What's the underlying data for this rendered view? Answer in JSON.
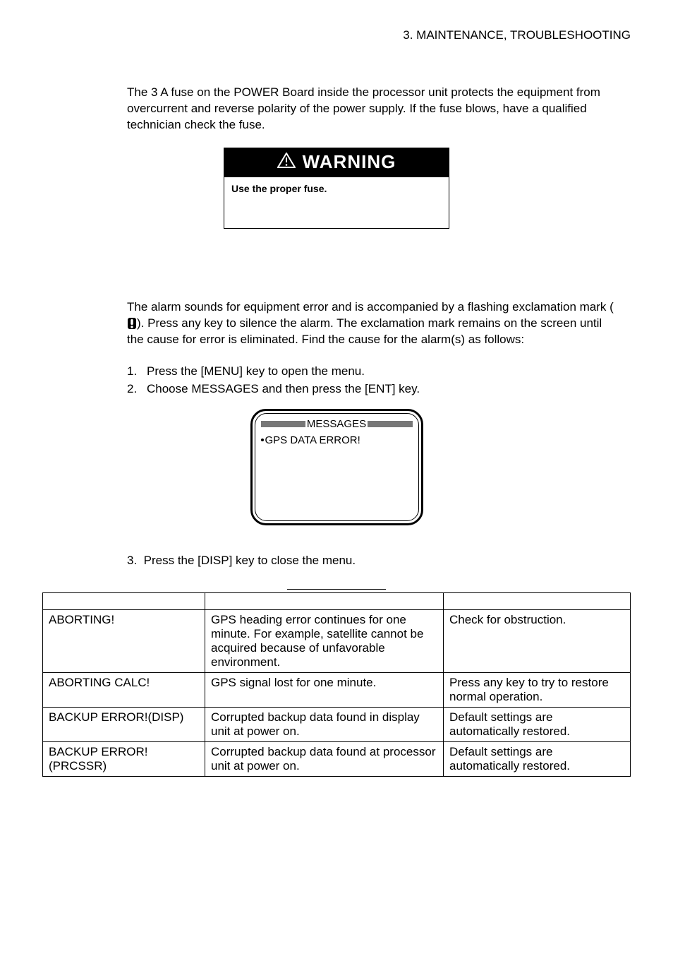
{
  "header": "3. MAINTENANCE, TROUBLESHOOTING",
  "para1": "The 3 A fuse on the POWER Board inside the processor unit protects the equipment from overcurrent and reverse polarity of the power supply. If the fuse blows, have a qualified technician check the fuse.",
  "warning": {
    "title": "WARNING",
    "body": "Use the proper fuse."
  },
  "para2a": "The alarm sounds for equipment error and is accompanied by a flashing exclamation mark (",
  "para2b": "). Press any key to silence the alarm. The exclamation mark remains on the screen until the cause for error is eliminated. Find the cause for the alarm(s) as follows:",
  "list": {
    "n1": "1.",
    "t1": "Press the [MENU] key to open the menu.",
    "n2": "2.",
    "t2": "Choose MESSAGES and then press the [ENT] key."
  },
  "messages": {
    "title": "MESSAGES",
    "content": "GPS DATA ERROR!"
  },
  "para3n": "3.",
  "para3": "Press the [DISP] key to close the menu.",
  "table": {
    "rows": [
      {
        "c1": "ABORTING!",
        "c2": "GPS heading error continues for one minute. For example, satellite cannot be acquired because of unfavorable environment.",
        "c3": "Check for obstruction."
      },
      {
        "c1": "ABORTING CALC!",
        "c2": "GPS signal lost for one minute.",
        "c3": "Press any key to try to restore normal operation."
      },
      {
        "c1": "BACKUP ERROR!(DISP)",
        "c2": "Corrupted backup data found in display unit at power on.",
        "c3": "Default settings are automatically restored."
      },
      {
        "c1": "BACKUP ERROR!(PRCSSR)",
        "c2": "Corrupted backup data found at processor unit at power on.",
        "c3": "Default settings are automatically restored."
      }
    ]
  }
}
